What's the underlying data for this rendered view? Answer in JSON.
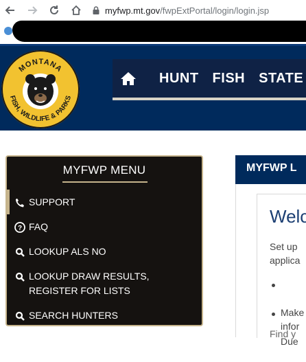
{
  "browser": {
    "url_host": "myfwp.mt.gov",
    "url_path": "/fwpExtPortal/login/login.jsp",
    "back_icon": "arrow-left-icon",
    "forward_icon": "arrow-right-icon",
    "reload_icon": "reload-icon",
    "home_icon": "home-icon"
  },
  "logo": {
    "top_text": "MONTANA",
    "bottom_text": "FISH, WILDLIFE & PARKS"
  },
  "topnav": {
    "items": [
      "HUNT",
      "FISH",
      "STATE"
    ]
  },
  "menu": {
    "title": "MYFWP MENU",
    "items": [
      {
        "label": "SUPPORT",
        "icon": "phone-icon"
      },
      {
        "label": "FAQ",
        "icon": "question-circle-icon"
      },
      {
        "label": "LOOKUP ALS NO",
        "icon": "search-icon"
      },
      {
        "label": "LOOKUP DRAW RESULTS,\nREGISTER FOR LISTS",
        "icon": "search-icon"
      },
      {
        "label": "SEARCH HUNTERS",
        "icon": "search-icon"
      }
    ]
  },
  "panel": {
    "header": "MYFWP L",
    "welcome": "Welc",
    "intro": "Set up\napplica",
    "bullets": [
      "Make\ninfor",
      "Due"
    ],
    "find": "Find y"
  },
  "colors": {
    "header_bg": "#002a5c",
    "menu_bg": "#151210",
    "accent_gold": "#c6b48c"
  }
}
